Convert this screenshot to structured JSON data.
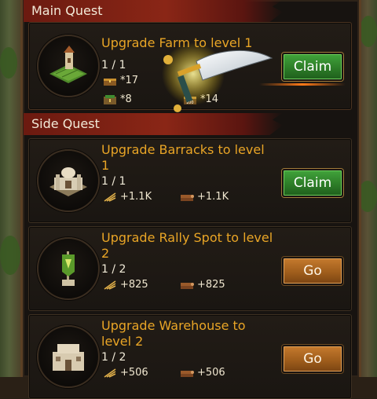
{
  "main_quest": {
    "header": "Main Quest",
    "title": "Upgrade Farm to level 1",
    "progress": "1 / 1",
    "rewards": [
      {
        "icon": "treasure-chest-icon",
        "value": "*17"
      },
      {
        "icon": "resource-crate-icon",
        "value": "*8"
      },
      {
        "icon": "chest-100-icon",
        "value": "*14"
      }
    ],
    "button_label": "Claim"
  },
  "side_quest": {
    "header": "Side Quest",
    "items": [
      {
        "title_line1": "Upgrade Barracks to level",
        "title_line2": "1",
        "progress": "1 / 1",
        "food_reward": "+1.1K",
        "wood_reward": "+1.1K",
        "button_label": "Claim"
      },
      {
        "title_line1": "Upgrade Rally Spot to level",
        "title_line2": "2",
        "progress": "1 / 2",
        "food_reward": "+825",
        "wood_reward": "+825",
        "button_label": "Go"
      },
      {
        "title_line1": "Upgrade Warehouse to",
        "title_line2": "level 2",
        "progress": "1 / 2",
        "food_reward": "+506",
        "wood_reward": "+506",
        "button_label": "Go"
      }
    ]
  },
  "colors": {
    "title": "#e9a526",
    "header_red": "#8a2616",
    "claim_green": "#2d7d28",
    "go_brown": "#a05e1c"
  }
}
